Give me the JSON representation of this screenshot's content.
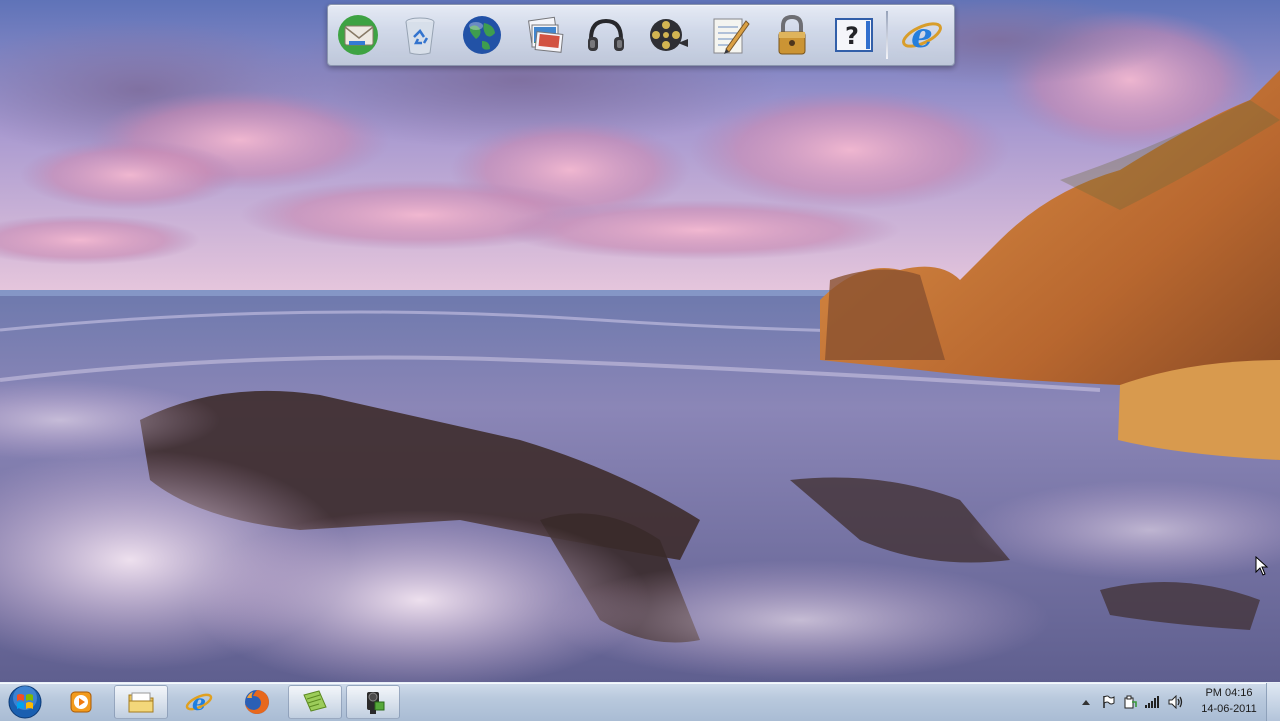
{
  "dock": {
    "items": [
      {
        "name": "mail",
        "icon": "mail-envelope-icon"
      },
      {
        "name": "recycle-bin",
        "icon": "recycle-bin-icon"
      },
      {
        "name": "internet",
        "icon": "globe-icon"
      },
      {
        "name": "photos",
        "icon": "photo-stack-icon"
      },
      {
        "name": "music",
        "icon": "headphones-icon"
      },
      {
        "name": "video",
        "icon": "film-reel-icon"
      },
      {
        "name": "notes",
        "icon": "notepad-pen-icon"
      },
      {
        "name": "security",
        "icon": "padlock-icon"
      },
      {
        "name": "help",
        "icon": "help-question-icon"
      },
      {
        "name": "internet-explorer",
        "icon": "internet-explorer-icon"
      }
    ]
  },
  "taskbar": {
    "pinned": [
      {
        "name": "windows-media-player",
        "icon": "media-player-icon",
        "active": false
      },
      {
        "name": "windows-explorer",
        "icon": "folder-icon",
        "active": true
      },
      {
        "name": "internet-explorer",
        "icon": "internet-explorer-icon",
        "active": false
      },
      {
        "name": "firefox",
        "icon": "firefox-icon",
        "active": false
      },
      {
        "name": "notepad-app",
        "icon": "green-document-icon",
        "active": true
      },
      {
        "name": "camera-app",
        "icon": "camcorder-icon",
        "active": true
      }
    ],
    "tray": [
      "show-hidden-icons-arrow",
      "action-center-flag-icon",
      "safely-remove-hardware-icon",
      "network-signal-icon",
      "volume-speaker-icon"
    ],
    "clock": {
      "time": "PM 04:16",
      "date": "14-06-2011"
    }
  },
  "colors": {
    "taskbar": "#b9c9dd",
    "dock": "#d7dfec",
    "sky": "#9f9ad4",
    "sea": "#6f72a8",
    "cliff": "#c0743a"
  }
}
